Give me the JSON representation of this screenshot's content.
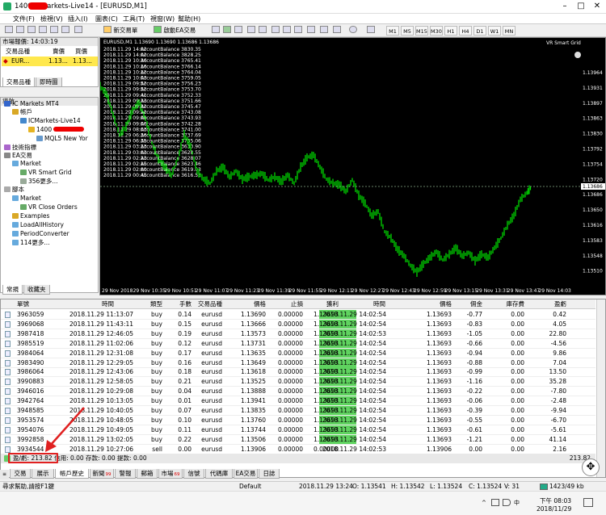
{
  "window": {
    "title": "1400 ICMarkets-Live14 - [EURUSD,M1]"
  },
  "menu": [
    "文件(F)",
    "檢視(V)",
    "插入(I)",
    "圖表(C)",
    "工具(T)",
    "視窗(W)",
    "幫助(H)"
  ],
  "toolbar": {
    "new_order": "新交易單",
    "auto_trading": "啟動EA交易",
    "timeframes": [
      "M1",
      "M5",
      "M15",
      "M30",
      "H1",
      "H4",
      "D1",
      "W1",
      "MN"
    ]
  },
  "market_watch": {
    "header": "市場報價: 14:03:19",
    "cols": [
      "交易品種",
      "賣價",
      "買價"
    ],
    "row": {
      "symbol": "EUR...",
      "bid": "1.13...",
      "ask": "1.13..."
    },
    "tabs": [
      "交易品種",
      "即時圖"
    ]
  },
  "navigator": {
    "header": "導航",
    "items": [
      "IC Markets MT4",
      "帳戶",
      "ICMarkets-Live14",
      "1400",
      "MQL5 New Yor",
      "技術指標",
      "EA交易",
      "Market",
      "VR Smart Grid",
      "356更多...",
      "腳本",
      "Market",
      "VR Close Orders",
      "Examples",
      "LoadAllHistory",
      "PeriodConverter",
      "114更多..."
    ],
    "tabs": [
      "常規",
      "收藏夹"
    ]
  },
  "chart": {
    "header": "EURUSD,M1  1.13690 1.13690 1.13686 1.13686",
    "expert": "VR Smart Grid",
    "bid_price": "1.13686",
    "balance_lines": [
      [
        "2018.11.29 14:02",
        "AccountBalance 3830.35"
      ],
      [
        "2018.11.29 14:02",
        "AccountBalance 3828.25"
      ],
      [
        "2018.11.29 10:36",
        "AccountBalance 3765.41"
      ],
      [
        "2018.11.29 10:16",
        "AccountBalance 3766.14"
      ],
      [
        "2018.11.29 10:12",
        "AccountBalance 3764.04"
      ],
      [
        "2018.11.29 10:03",
        "AccountBalance 3759.05"
      ],
      [
        "2018.11.29 09:52",
        "AccountBalance 3756.23"
      ],
      [
        "2018.11.29 09:52",
        "AccountBalance 3753.70"
      ],
      [
        "2018.11.29 09:41",
        "AccountBalance 3752.33"
      ],
      [
        "2018.11.29 09:33",
        "AccountBalance 3751.66"
      ],
      [
        "2018.11.29 09:32",
        "AccountBalance 3745.47"
      ],
      [
        "2018.11.29 09:12",
        "AccountBalance 3743.08"
      ],
      [
        "2018.11.29 09:09",
        "AccountBalance 3743.93"
      ],
      [
        "2018.11.29 09:00",
        "AccountBalance 3742.28"
      ],
      [
        "2018.11.29 08:03",
        "AccountBalance 3741.00"
      ],
      [
        "2018.11.29 06:36",
        "AccountBalance 3737.69"
      ],
      [
        "2018.11.29 06:35",
        "AccountBalance 3735.06"
      ],
      [
        "2018.11.29 03:23",
        "AccountBalance 3630.90"
      ],
      [
        "2018.11.29 03:03",
        "AccountBalance 3628.55"
      ],
      [
        "2018.11.29 02:23",
        "AccountBalance 3628.07"
      ],
      [
        "2018.11.29 02:15",
        "AccountBalance 3623.46"
      ],
      [
        "2018.11.29 02:00",
        "AccountBalance 3619.03"
      ],
      [
        "2018.11.29 00:45",
        "AccountBalance 3616.53"
      ]
    ],
    "price_ticks": [
      "1.13964",
      "1.13931",
      "1.13897",
      "1.13863",
      "1.13830",
      "1.13792",
      "1.13754",
      "1.13720",
      "1.13686",
      "1.13650",
      "1.13616",
      "1.13583",
      "1.13548",
      "1.13510"
    ],
    "time_ticks": [
      "29 Nov 2018",
      "29 Nov 10:35",
      "29 Nov 10:51",
      "29 Nov 11:07",
      "29 Nov 11:23",
      "29 Nov 11:39",
      "29 Nov 11:55",
      "29 Nov 12:11",
      "29 Nov 12:27",
      "29 Nov 12:43",
      "29 Nov 12:59",
      "29 Nov 13:15",
      "29 Nov 13:31",
      "29 Nov 13:47",
      "29 Nov 14:03"
    ]
  },
  "terminal": {
    "columns": [
      "單號",
      "時間",
      "類型",
      "手數",
      "交易品種",
      "價格",
      "止損",
      "獲利",
      "時間",
      "價格",
      "佣金",
      "庫存費",
      "盈虧"
    ],
    "rows": [
      [
        "3963059",
        "2018.11.29 11:13:07",
        "buy",
        "0.14",
        "eurusd",
        "1.13690",
        "0.00000",
        "1.13693",
        "2018.11.29 14:02:54",
        "1.13693",
        "-0.77",
        "0.00",
        "0.42"
      ],
      [
        "3969068",
        "2018.11.29 11:43:11",
        "buy",
        "0.15",
        "eurusd",
        "1.13666",
        "0.00000",
        "1.13693",
        "2018.11.29 14:02:54",
        "1.13693",
        "-0.83",
        "0.00",
        "4.05"
      ],
      [
        "3987418",
        "2018.11.29 12:46:05",
        "buy",
        "0.19",
        "eurusd",
        "1.13573",
        "0.00000",
        "1.13693",
        "2018.11.29 14:02:53",
        "1.13693",
        "-1.05",
        "0.00",
        "22.80"
      ],
      [
        "3985519",
        "2018.11.29 11:02:06",
        "buy",
        "0.12",
        "eurusd",
        "1.13731",
        "0.00000",
        "1.13693",
        "2018.11.29 14:02:54",
        "1.13693",
        "-0.66",
        "0.00",
        "-4.56"
      ],
      [
        "3984064",
        "2018.11.29 12:31:08",
        "buy",
        "0.17",
        "eurusd",
        "1.13635",
        "0.00000",
        "1.13693",
        "2018.11.29 14:02:54",
        "1.13693",
        "-0.94",
        "0.00",
        "9.86"
      ],
      [
        "3983490",
        "2018.11.29 12:29:05",
        "buy",
        "0.16",
        "eurusd",
        "1.13649",
        "0.00000",
        "1.13693",
        "2018.11.29 14:02:54",
        "1.13693",
        "-0.88",
        "0.00",
        "7.04"
      ],
      [
        "3986064",
        "2018.11.29 12:43:06",
        "buy",
        "0.18",
        "eurusd",
        "1.13618",
        "0.00000",
        "1.13693",
        "2018.11.29 14:02:54",
        "1.13693",
        "-0.99",
        "0.00",
        "13.50"
      ],
      [
        "3990883",
        "2018.11.29 12:58:05",
        "buy",
        "0.21",
        "eurusd",
        "1.13525",
        "0.00000",
        "1.13693",
        "2018.11.29 14:02:54",
        "1.13693",
        "-1.16",
        "0.00",
        "35.28"
      ],
      [
        "3946016",
        "2018.11.29 10:29:08",
        "buy",
        "0.04",
        "eurusd",
        "1.13888",
        "0.00000",
        "1.13693",
        "2018.11.29 14:02:54",
        "1.13693",
        "-0.22",
        "0.00",
        "-7.80"
      ],
      [
        "3942764",
        "2018.11.29 10:13:05",
        "buy",
        "0.01",
        "eurusd",
        "1.13941",
        "0.00000",
        "1.13693",
        "2018.11.29 14:02:54",
        "1.13693",
        "-0.06",
        "0.00",
        "-2.48"
      ],
      [
        "3948585",
        "2018.11.29 10:40:05",
        "buy",
        "0.07",
        "eurusd",
        "1.13835",
        "0.00000",
        "1.13693",
        "2018.11.29 14:02:54",
        "1.13693",
        "-0.39",
        "0.00",
        "-9.94"
      ],
      [
        "3953574",
        "2018.11.29 10:48:05",
        "buy",
        "0.10",
        "eurusd",
        "1.13760",
        "0.00000",
        "1.13693",
        "2018.11.29 14:02:54",
        "1.13693",
        "-0.55",
        "0.00",
        "-6.70"
      ],
      [
        "3954076",
        "2018.11.29 10:49:05",
        "buy",
        "0.11",
        "eurusd",
        "1.13744",
        "0.00000",
        "1.13693",
        "2018.11.29 14:02:54",
        "1.13693",
        "-0.61",
        "0.00",
        "-5.61"
      ],
      [
        "3992858",
        "2018.11.29 13:02:05",
        "buy",
        "0.22",
        "eurusd",
        "1.13506",
        "0.00000",
        "1.13693",
        "2018.11.29 14:02:54",
        "1.13693",
        "-1.21",
        "0.00",
        "41.14"
      ],
      [
        "3934544",
        "2018.11.29 10:27:06",
        "sell",
        "0.00",
        "eurusd",
        "1.13906",
        "0.00000",
        "0.00000",
        "2018.11.29 14:02:53",
        "1.13906",
        "0.00",
        "0.00",
        "2.16"
      ]
    ],
    "summary": "盈/虧: 213.82  信用: 0.00  存款: 0.00  提款: 0.00",
    "summary_total": "213.82",
    "tabs": [
      "交易",
      "展示",
      "帳戶歷史",
      "新聞",
      "警報",
      "郵箱",
      "市場",
      "信號",
      "代碼庫",
      "EA交易",
      "日誌"
    ],
    "news_badge": "99",
    "market_badge": "69"
  },
  "status": {
    "help": "尋求幫助,請按F1鍵",
    "profile": "Default",
    "time": "2018.11.29 13:24",
    "open": "O: 1.13541",
    "high": "H: 1.13542",
    "low": "L: 1.13524",
    "close": "C: 1.13524",
    "vol": "V: 31",
    "mem": "1423/49 kb"
  },
  "taskbar": {
    "time": "下午 08:03",
    "date": "2018/11/29"
  },
  "colors": {
    "chart_bg": "#000000",
    "candle": "#00ff00",
    "summary_highlight": "#ff0000",
    "tp_cell": "#5fd35f"
  }
}
